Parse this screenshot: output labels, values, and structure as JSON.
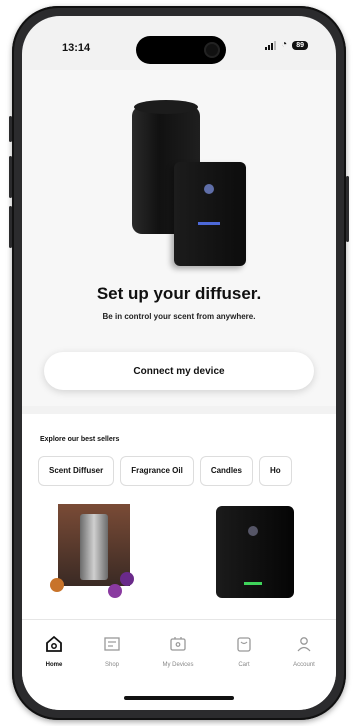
{
  "status_bar": {
    "time": "13:14",
    "battery": "89"
  },
  "hero": {
    "title": "Set up your diffuser.",
    "subtitle": "Be in control your scent from anywhere.",
    "connect_label": "Connect my device"
  },
  "sellers": {
    "title": "Explore our best sellers",
    "chips": [
      {
        "label": "Scent Diffuser"
      },
      {
        "label": "Fragrance Oil"
      },
      {
        "label": "Candles"
      },
      {
        "label": "Ho"
      }
    ]
  },
  "nav": {
    "items": [
      {
        "label": "Home",
        "icon": "home-icon"
      },
      {
        "label": "Shop",
        "icon": "shop-icon"
      },
      {
        "label": "My Devices",
        "icon": "devices-icon"
      },
      {
        "label": "Cart",
        "icon": "cart-icon"
      },
      {
        "label": "Account",
        "icon": "account-icon"
      }
    ],
    "active": "Home"
  },
  "colors": {
    "background": "#f2f2f2",
    "accent_blue": "#4d69d8",
    "accent_green": "#3fd45b",
    "phone_frame": "#2b2b2d"
  }
}
